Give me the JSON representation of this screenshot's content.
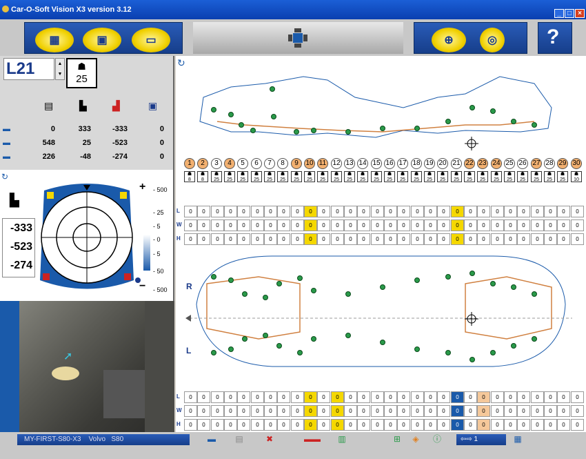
{
  "window": {
    "title": "Car-O-Soft Vision X3 version 3.12"
  },
  "point_select": {
    "code": "L21",
    "tag_value": "25"
  },
  "measure_table": {
    "rows": [
      {
        "icon": "car-length-icon",
        "values": [
          "0",
          "333",
          "-333",
          "0"
        ]
      },
      {
        "icon": "car-width-icon",
        "values": [
          "548",
          "25",
          "-523",
          "0"
        ]
      },
      {
        "icon": "car-height-icon",
        "values": [
          "226",
          "-48",
          "-274",
          "0"
        ]
      }
    ]
  },
  "target": {
    "deviations": [
      "-333",
      "-523",
      "-274"
    ],
    "scale_labels": [
      "500",
      "25",
      "5",
      "0",
      "5",
      "50",
      "500"
    ],
    "plus": "+",
    "minus": "−"
  },
  "diagram": {
    "point_numbers": [
      "1",
      "2",
      "3",
      "4",
      "5",
      "6",
      "7",
      "8",
      "9",
      "10",
      "11",
      "12",
      "13",
      "14",
      "15",
      "16",
      "17",
      "18",
      "19",
      "20",
      "21",
      "22",
      "23",
      "24",
      "25",
      "26",
      "27",
      "28",
      "29",
      "30"
    ],
    "highlighted_numbers": [
      1,
      2,
      4,
      9,
      10,
      11,
      22,
      23,
      24,
      27,
      29,
      30
    ],
    "icon_values": [
      "8",
      "8",
      "25",
      "25",
      "25",
      "25",
      "25",
      "25",
      "25",
      "25",
      "25",
      "25",
      "25",
      "25",
      "25",
      "25",
      "25",
      "25",
      "25",
      "25",
      "25",
      "25",
      "25",
      "25",
      "25",
      "25",
      "25",
      "25",
      "25",
      "10"
    ],
    "upper_rows": [
      {
        "label": "L",
        "values": [
          "0",
          "0",
          "0",
          "0",
          "0",
          "0",
          "0",
          "0",
          "0",
          "0",
          "0",
          "0",
          "0",
          "0",
          "0",
          "0",
          "0",
          "0",
          "0",
          "0",
          "0",
          "0",
          "0",
          "0",
          "0",
          "0",
          "0",
          "0",
          "0",
          "0"
        ]
      },
      {
        "label": "W",
        "values": [
          "0",
          "0",
          "0",
          "0",
          "0",
          "0",
          "0",
          "0",
          "0",
          "0",
          "0",
          "0",
          "0",
          "0",
          "0",
          "0",
          "0",
          "0",
          "0",
          "0",
          "0",
          "0",
          "0",
          "0",
          "0",
          "0",
          "0",
          "0",
          "0",
          "0"
        ]
      },
      {
        "label": "H",
        "values": [
          "0",
          "0",
          "0",
          "0",
          "0",
          "0",
          "0",
          "0",
          "0",
          "0",
          "0",
          "0",
          "0",
          "0",
          "0",
          "0",
          "0",
          "0",
          "0",
          "0",
          "0",
          "0",
          "0",
          "0",
          "0",
          "0",
          "0",
          "0",
          "0",
          "0"
        ]
      }
    ],
    "lower_rows": [
      {
        "label": "L",
        "values": [
          "0",
          "0",
          "0",
          "0",
          "0",
          "0",
          "0",
          "0",
          "0",
          "0",
          "0",
          "0",
          "0",
          "0",
          "0",
          "0",
          "0",
          "0",
          "0",
          "0",
          "0",
          "0",
          "0",
          "0",
          "0",
          "0",
          "0",
          "0",
          "0",
          "0"
        ]
      },
      {
        "label": "W",
        "values": [
          "0",
          "0",
          "0",
          "0",
          "0",
          "0",
          "0",
          "0",
          "0",
          "0",
          "0",
          "0",
          "0",
          "0",
          "0",
          "0",
          "0",
          "0",
          "0",
          "0",
          "0",
          "0",
          "0",
          "0",
          "0",
          "0",
          "0",
          "0",
          "0",
          "0"
        ]
      },
      {
        "label": "H",
        "values": [
          "0",
          "0",
          "0",
          "0",
          "0",
          "0",
          "0",
          "0",
          "0",
          "0",
          "0",
          "0",
          "0",
          "0",
          "0",
          "0",
          "0",
          "0",
          "0",
          "0",
          "0",
          "0",
          "0",
          "0",
          "0",
          "0",
          "0",
          "0",
          "0",
          "0"
        ]
      }
    ],
    "side_labels": {
      "right": "R",
      "left": "L"
    }
  },
  "statusbar": {
    "vehicle_label": "MY-FIRST-S80-X3",
    "make": "Volvo",
    "model": "S80",
    "page_num": "1"
  },
  "colors": {
    "accent_blue": "#1a3a8a",
    "highlight_yellow": "#f5d800",
    "point_orange": "#f2b070",
    "point_green": "#2a9a4a"
  }
}
